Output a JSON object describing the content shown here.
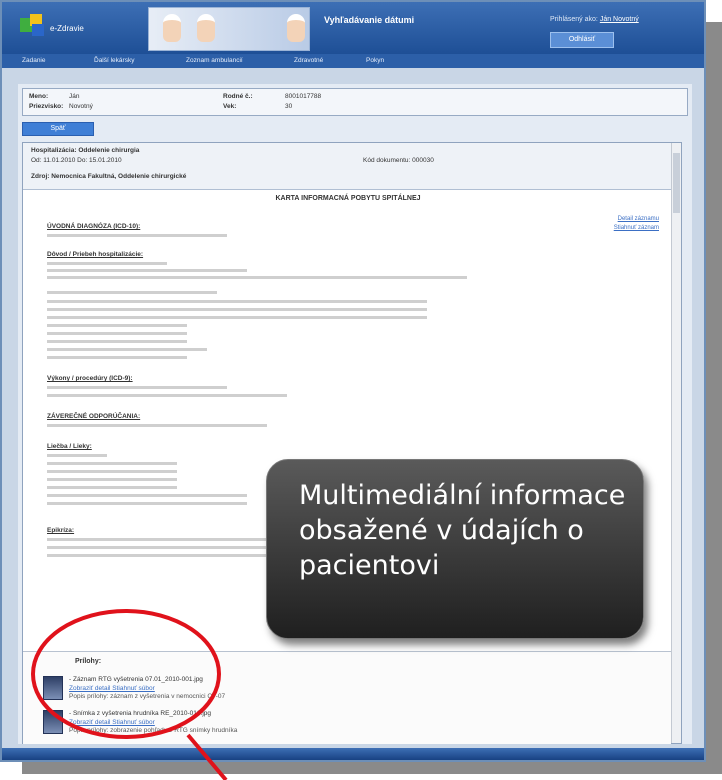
{
  "app": {
    "brand": "e-Zdravie",
    "title": "Vyhľadávanie dátumi",
    "login_label": "Prihlásený ako:",
    "login_user": "Ján Novotný",
    "logout_label": "Odhlásiť"
  },
  "nav": [
    "Zadanie",
    "Ďalší lekársky",
    "Zoznam ambulancií",
    "Zdravotné",
    "Pokyn"
  ],
  "patient": {
    "name_label": "Meno:",
    "name_value": "Ján",
    "surname_label": "Priezvisko:",
    "surname_value": "Novotný",
    "id_label": "Rodné č.:",
    "id_value": "8001017788",
    "age_label": "Vek:",
    "age_value": "30"
  },
  "back_button": "Späť",
  "document": {
    "head_line1": "Hospitalizácia: Oddelenie chirurgia",
    "head_dates": "Od: 11.01.2010   Do: 15.01.2010",
    "head_code": "Kód dokumentu: 000030",
    "head_line3": "Zdroj: Nemocnica Fakultná, Oddelenie chirurgické",
    "title": "KARTA INFORMACNÁ POBYTU SPITÁLNEJ",
    "side_links": [
      "Detail záznamu",
      "Stiahnuť záznam"
    ],
    "sections": [
      "ÚVODNÁ DIAGNÓZA (ICD-10):",
      "Dôvod / Priebeh hospitalizácie:",
      "Výkony / procedúry (ICD-9):",
      "ZÁVEREČNÉ ODPORÚČANIA:",
      "Liečba / Lieky:",
      "Epikríza:"
    ]
  },
  "attachments": {
    "label": "Prílohy:",
    "items": [
      {
        "title": "- Záznam RTG vyšetrenia 07.01_2010-001.jpg",
        "links": "Zobraziť detail   Stiahnuť súbor",
        "desc": "Popis prílohy: záznam z vyšetrenia v nemocnici CT-07"
      },
      {
        "title": "- Snímka z vyšetrenia hrudníka RE_2010-016.jpg",
        "links": "Zobraziť detail   Stiahnuť súbor",
        "desc": "Popis prílohy: zobrazenie pohľadu z RTG snímky hrudníka"
      }
    ]
  },
  "callout": {
    "text": "Multimediální informace obsažené v údajích o pacientovi"
  },
  "colors": {
    "callout_bg": "#2e2e2e",
    "highlight_ring": "#e0121b",
    "header_blue": "#2c5fa8"
  }
}
